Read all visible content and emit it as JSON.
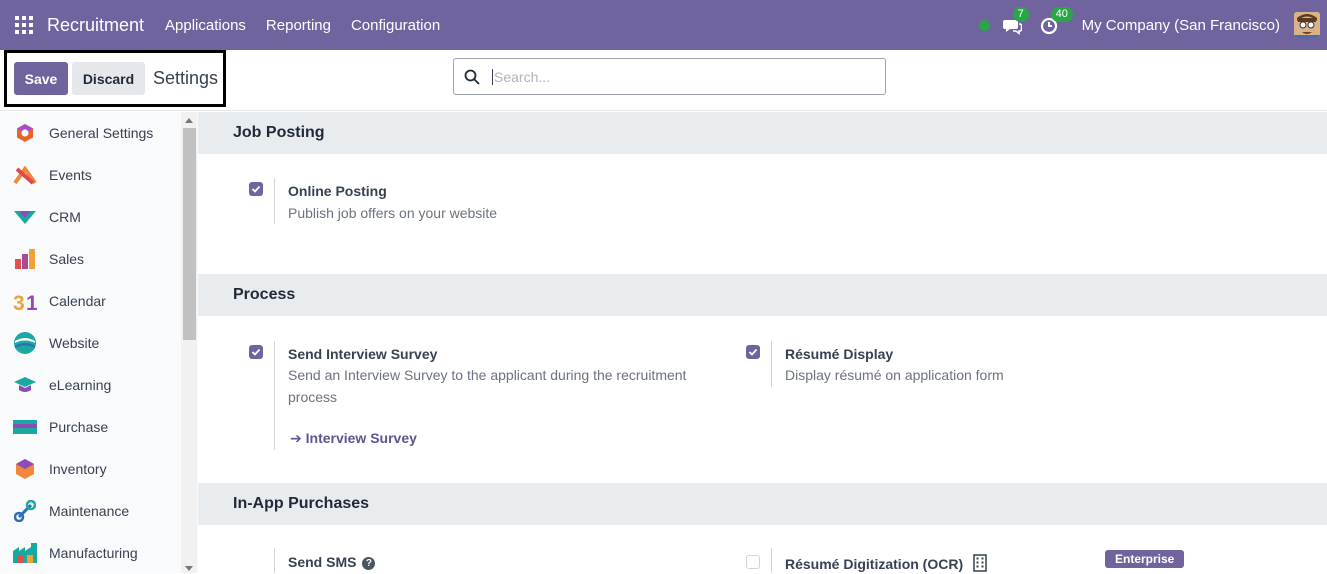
{
  "navbar": {
    "app_name": "Recruitment",
    "menu": [
      "Applications",
      "Reporting",
      "Configuration"
    ],
    "messages_count": "7",
    "activities_count": "40",
    "company": "My Company (San Francisco)"
  },
  "control": {
    "save_label": "Save",
    "discard_label": "Discard",
    "title": "Settings",
    "search_placeholder": "Search..."
  },
  "sidebar": {
    "items": [
      {
        "label": "General Settings",
        "icon": "general-settings-icon"
      },
      {
        "label": "Events",
        "icon": "events-icon"
      },
      {
        "label": "CRM",
        "icon": "crm-icon"
      },
      {
        "label": "Sales",
        "icon": "sales-icon"
      },
      {
        "label": "Calendar",
        "icon": "calendar-icon"
      },
      {
        "label": "Website",
        "icon": "website-icon"
      },
      {
        "label": "eLearning",
        "icon": "elearning-icon"
      },
      {
        "label": "Purchase",
        "icon": "purchase-icon"
      },
      {
        "label": "Inventory",
        "icon": "inventory-icon"
      },
      {
        "label": "Maintenance",
        "icon": "maintenance-icon"
      },
      {
        "label": "Manufacturing",
        "icon": "manufacturing-icon"
      }
    ]
  },
  "sections": {
    "job_posting": {
      "title": "Job Posting",
      "online_posting": {
        "label": "Online Posting",
        "desc": "Publish job offers on your website",
        "checked": true
      }
    },
    "process": {
      "title": "Process",
      "interview_survey": {
        "label": "Send Interview Survey",
        "desc": "Send an Interview Survey to the applicant during the recruitment process",
        "link": "Interview Survey",
        "checked": true
      },
      "resume_display": {
        "label": "Résumé Display",
        "desc": "Display résumé on application form",
        "checked": true
      }
    },
    "in_app": {
      "title": "In-App Purchases",
      "send_sms": {
        "label": "Send SMS"
      },
      "resume_ocr": {
        "label": "Résumé Digitization (OCR)",
        "checked": false,
        "badge": "Enterprise"
      }
    }
  },
  "colors": {
    "brand": "#71639e",
    "green": "#28a745"
  }
}
